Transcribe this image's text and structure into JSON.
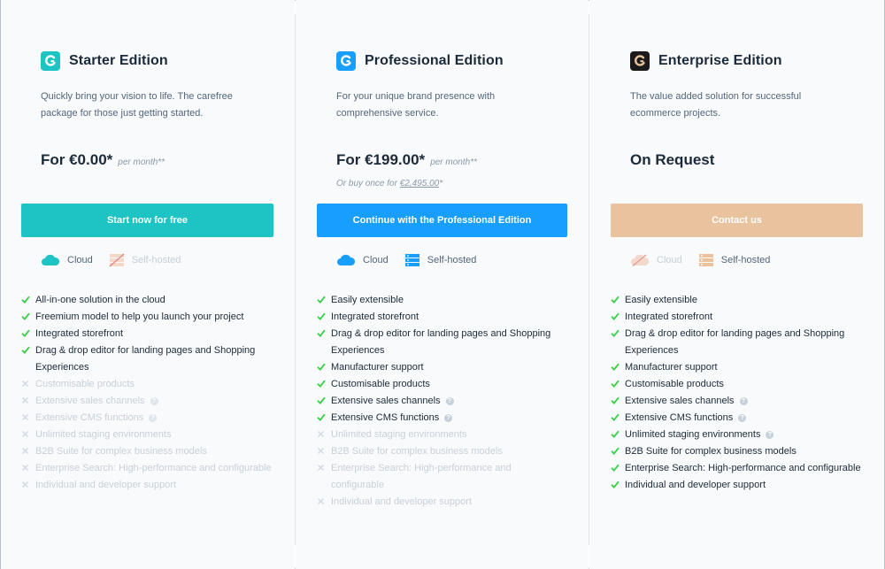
{
  "colors": {
    "starter_button": "#1ec3c3",
    "professional_button": "#189eff",
    "enterprise_button": "#e8c39e",
    "check": "#37d046"
  },
  "plans": [
    {
      "title": "Starter Edition",
      "description": [
        "Quickly bring your vision to life. The carefree",
        "package for those just getting started."
      ],
      "price": "For €0.00*",
      "price_unit": "per month**",
      "button_label": "Start now for free",
      "hosting": [
        {
          "label": "Cloud",
          "available": true,
          "icon": "cloud-icon"
        },
        {
          "label": "Self-hosted",
          "available": false,
          "icon": "server-icon"
        }
      ],
      "features": [
        {
          "text": "All-in-one solution in the cloud",
          "included": true
        },
        {
          "text": "Freemium model to help you launch your project",
          "included": true
        },
        {
          "text": "Integrated storefront",
          "included": true
        },
        {
          "text": "Drag & drop editor for landing pages and Shopping",
          "text2": "Experiences",
          "included": true
        },
        {
          "text": "Customisable products",
          "included": false
        },
        {
          "text": "Extensive sales channels",
          "included": false,
          "help": true
        },
        {
          "text": "Extensive CMS functions",
          "included": false,
          "help": true
        },
        {
          "text": "Unlimited staging environments",
          "included": false
        },
        {
          "text": "B2B Suite for complex business models",
          "included": false
        },
        {
          "text": "Enterprise Search: High-performance and configurable",
          "included": false
        },
        {
          "text": "Individual and developer support",
          "included": false
        }
      ]
    },
    {
      "title": "Professional Edition",
      "description": [
        "For your unique brand presence with",
        "comprehensive service."
      ],
      "price": "For €199.00*",
      "price_unit": "per month**",
      "once_prefix": "Or buy once for ",
      "once_price": "€2,495.00",
      "once_suffix": "*",
      "button_label": "Continue with the Professional Edition",
      "hosting": [
        {
          "label": "Cloud",
          "available": true,
          "icon": "cloud-icon"
        },
        {
          "label": "Self-hosted",
          "available": true,
          "icon": "server-icon"
        }
      ],
      "features": [
        {
          "text": "Easily extensible",
          "included": true
        },
        {
          "text": "Integrated storefront",
          "included": true
        },
        {
          "text": "Drag & drop editor for landing pages and Shopping",
          "text2": "Experiences",
          "included": true
        },
        {
          "text": "Manufacturer support",
          "included": true
        },
        {
          "text": "Customisable products",
          "included": true
        },
        {
          "text": "Extensive sales channels",
          "included": true,
          "help": true
        },
        {
          "text": "Extensive CMS functions",
          "included": true,
          "help": true
        },
        {
          "text": "Unlimited staging environments",
          "included": false
        },
        {
          "text": "B2B Suite for complex business models",
          "included": false
        },
        {
          "text": "Enterprise Search: High-performance and",
          "text2": "configurable",
          "included": false
        },
        {
          "text": "Individual and developer support",
          "included": false
        }
      ]
    },
    {
      "title": "Enterprise Edition",
      "description": [
        "The value added solution for successful",
        "ecommerce projects."
      ],
      "price": "On Request",
      "button_label": "Contact us",
      "hosting": [
        {
          "label": "Cloud",
          "available": false,
          "icon": "cloud-icon"
        },
        {
          "label": "Self-hosted",
          "available": true,
          "icon": "server-icon"
        }
      ],
      "features": [
        {
          "text": "Easily extensible",
          "included": true
        },
        {
          "text": "Integrated storefront",
          "included": true
        },
        {
          "text": "Drag & drop editor for landing pages and Shopping",
          "text2": "Experiences",
          "included": true
        },
        {
          "text": "Manufacturer support",
          "included": true
        },
        {
          "text": "Customisable products",
          "included": true
        },
        {
          "text": "Extensive sales channels",
          "included": true,
          "help": true
        },
        {
          "text": "Extensive CMS functions",
          "included": true,
          "help": true
        },
        {
          "text": "Unlimited staging environments",
          "included": true,
          "help": true
        },
        {
          "text": "B2B Suite for complex business models",
          "included": true
        },
        {
          "text": "Enterprise Search: High-performance and configurable",
          "included": true
        },
        {
          "text": "Individual and developer support",
          "included": true
        }
      ]
    }
  ]
}
